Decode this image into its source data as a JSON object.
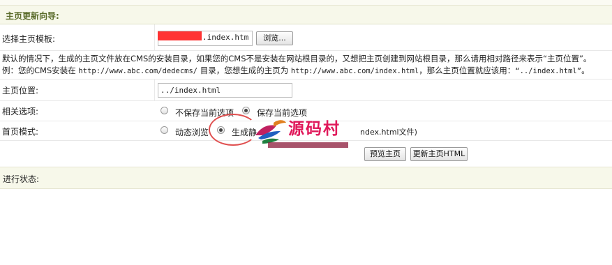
{
  "header": {
    "title": "主页更新向导:"
  },
  "template": {
    "label": "选择主页模板:",
    "value": ".index.htm",
    "browse_label": "浏览..."
  },
  "notice": {
    "line1": "默认的情况下，生成的主页文件放在CMS的安装目录，如果您的CMS不是安装在网站根目录的，又想把主页创建到网站根目录，那么请用相对路径来表示“主页位置”。",
    "line2_prefix": "例：您的CMS安装在 ",
    "line2_url1": "http://www.abc.com/dedecms/",
    "line2_mid": " 目录，您想生成的主页为 ",
    "line2_url2": "http://www.abc.com/index.html",
    "line2_mid2": "，那么主页位置就应该用：",
    "line2_path": "“../index.html”",
    "line2_end": "。"
  },
  "position": {
    "label": "主页位置:",
    "value": "../index.html"
  },
  "options": {
    "label": "相关选项:",
    "no_save": "不保存当前选项",
    "save": "保存当前选项",
    "selected": "save"
  },
  "mode": {
    "label": "首页模式:",
    "dynamic": "动态浏览",
    "static": "生成静",
    "static_tail": "ndex.html文件)",
    "selected": "static"
  },
  "buttons": {
    "preview": "预览主页",
    "update": "更新主页HTML"
  },
  "status": {
    "label": "进行状态:"
  },
  "watermark": {
    "text": "源码村",
    "color": "#e0185a"
  }
}
